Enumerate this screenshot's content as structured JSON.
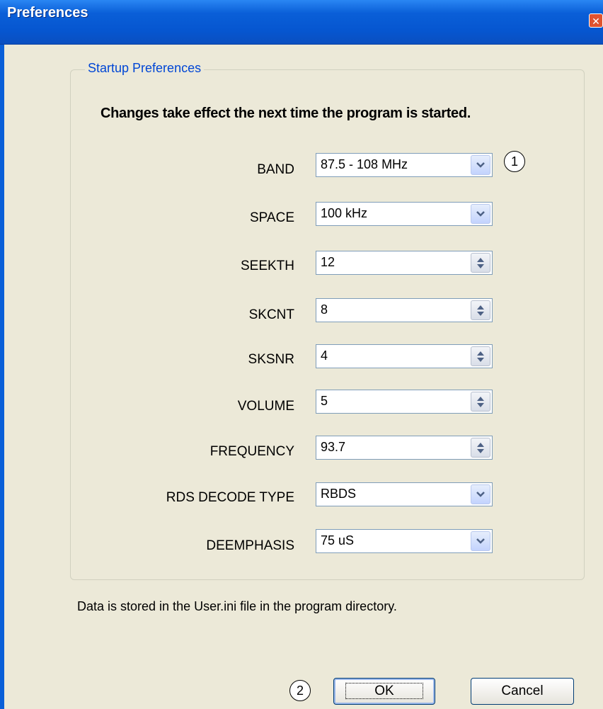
{
  "window": {
    "title": "Preferences",
    "close_glyph": "✕"
  },
  "group": {
    "legend": "Startup Preferences",
    "notice": "Changes take effect the next time the program is started."
  },
  "fields": [
    {
      "label": "BAND",
      "value": "87.5 - 108 MHz",
      "kind": "dropdown"
    },
    {
      "label": "SPACE",
      "value": "100 kHz",
      "kind": "dropdown"
    },
    {
      "label": "SEEKTH",
      "value": "12",
      "kind": "spinner"
    },
    {
      "label": "SKCNT",
      "value": "8",
      "kind": "spinner"
    },
    {
      "label": "SKSNR",
      "value": "4",
      "kind": "spinner"
    },
    {
      "label": "VOLUME",
      "value": "5",
      "kind": "spinner"
    },
    {
      "label": "FREQUENCY",
      "value": "93.7",
      "kind": "spinner"
    },
    {
      "label": "RDS DECODE TYPE",
      "value": "RBDS",
      "kind": "dropdown"
    },
    {
      "label": "DEEMPHASIS",
      "value": "75 uS",
      "kind": "dropdown"
    }
  ],
  "footer_note": "Data is stored in the User.ini file in the program directory.",
  "buttons": {
    "ok": "OK",
    "cancel": "Cancel"
  },
  "callouts": {
    "one": "1",
    "two": "2"
  },
  "colors": {
    "titlebar": "#0a5fd8",
    "dialog_bg": "#ece9d8",
    "legend_text": "#0046d5"
  }
}
